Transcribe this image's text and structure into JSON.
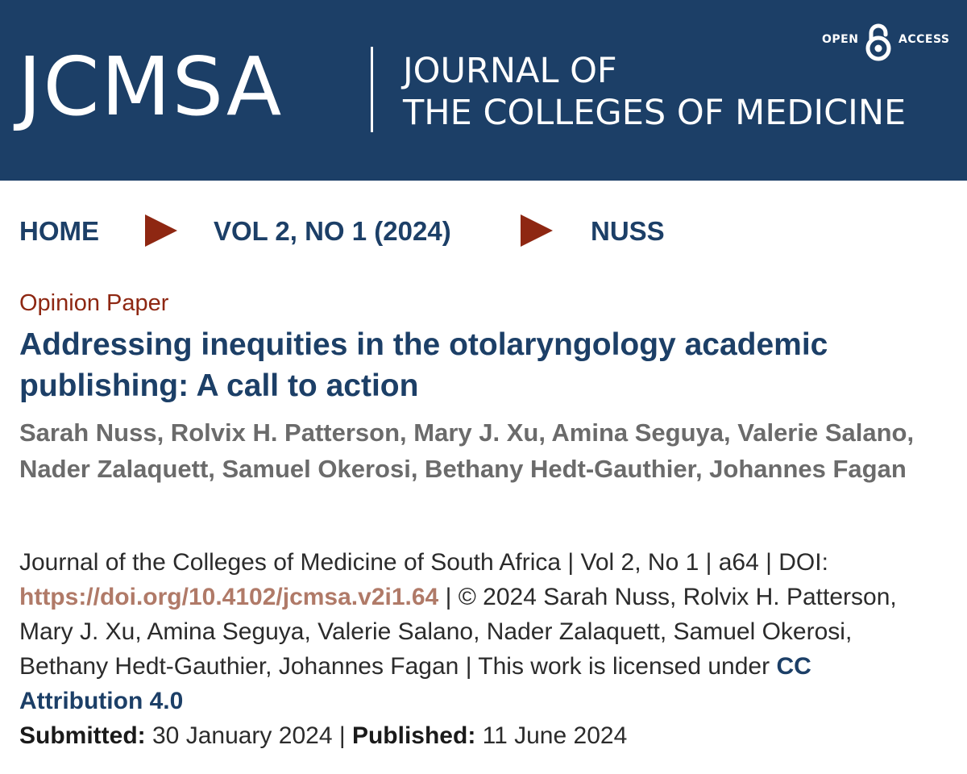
{
  "header": {
    "brand": "JCMSA",
    "journal_line1": "JOURNAL OF",
    "journal_line2": "THE COLLEGES OF MEDICINE",
    "open_access_left": "OPEN",
    "open_access_right": "ACCESS",
    "background_color": "#1c3f67"
  },
  "breadcrumb": {
    "items": [
      "HOME",
      "VOL 2, NO 1 (2024)",
      "NUSS"
    ],
    "separator_icon": "triangle-right-icon",
    "separator_color": "#8e2712"
  },
  "article": {
    "type": "Opinion Paper",
    "title": "Addressing inequities in the otolaryngology academic publishing: A call to action",
    "authors": "Sarah Nuss, Rolvix H. Patterson, Mary J. Xu, Amina Seguya, Valerie Salano, Nader Zalaquett, Samuel Okerosi, Bethany Hedt-Gauthier, Johannes Fagan"
  },
  "citation": {
    "journal_info": "Journal of the Colleges of Medicine of South Africa | Vol 2, No 1 | a64 | DOI: ",
    "doi_url": "https://doi.org/10.4102/jcmsa.v2i1.64",
    "copyright": " | © 2024 Sarah Nuss, Rolvix H. Patterson, Mary J. Xu, Amina Seguya, Valerie Salano, Nader Zalaquett, Samuel Okerosi, Bethany Hedt-Gauthier, Johannes Fagan | This work is licensed under ",
    "license_label": "CC Attribution 4.0",
    "submitted_label": "Submitted:",
    "submitted_date": " 30 January 2024 | ",
    "published_label": "Published:",
    "published_date": " 11 June 2024"
  }
}
